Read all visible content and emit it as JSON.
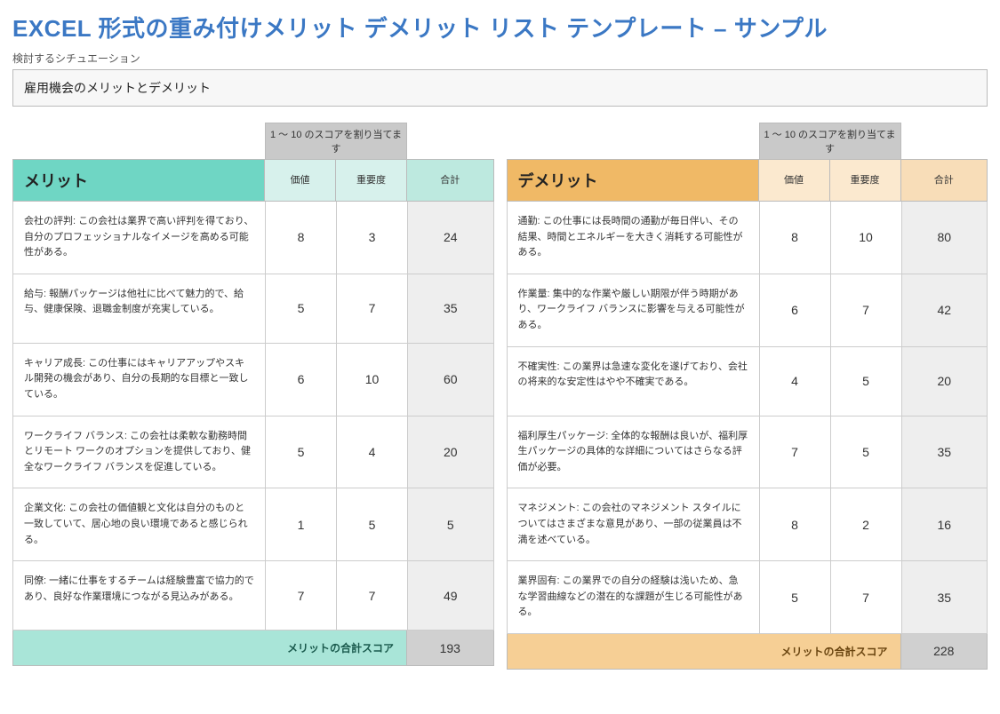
{
  "title": "EXCEL 形式の重み付けメリット デメリット リスト テンプレート – サンプル",
  "subtitle": "検討するシチュエーション",
  "situation": "雇用機会のメリットとデメリット",
  "score_note": "1 ～ 10 のスコアを割り当てます",
  "headers": {
    "value": "価値",
    "importance": "重要度",
    "total": "合計"
  },
  "pros": {
    "heading": "メリット",
    "total_label": "メリットの合計スコア",
    "total_score": "193",
    "rows": [
      {
        "desc": "会社の評判: この会社は業界で高い評判を得ており、自分のプロフェッショナルなイメージを高める可能性がある。",
        "value": "8",
        "importance": "3",
        "total": "24"
      },
      {
        "desc": "給与: 報酬パッケージは他社に比べて魅力的で、給与、健康保険、退職金制度が充実している。",
        "value": "5",
        "importance": "7",
        "total": "35"
      },
      {
        "desc": "キャリア成長: この仕事にはキャリアアップやスキル開発の機会があり、自分の長期的な目標と一致している。",
        "value": "6",
        "importance": "10",
        "total": "60"
      },
      {
        "desc": "ワークライフ バランス: この会社は柔軟な勤務時間とリモート ワークのオプションを提供しており、健全なワークライフ バランスを促進している。",
        "value": "5",
        "importance": "4",
        "total": "20"
      },
      {
        "desc": "企業文化: この会社の価値観と文化は自分のものと一致していて、居心地の良い環境であると感じられる。",
        "value": "1",
        "importance": "5",
        "total": "5"
      },
      {
        "desc": "同僚: 一緒に仕事をするチームは経験豊富で協力的であり、良好な作業環境につながる見込みがある。",
        "value": "7",
        "importance": "7",
        "total": "49"
      }
    ]
  },
  "cons": {
    "heading": "デメリット",
    "total_label": "メリットの合計スコア",
    "total_score": "228",
    "rows": [
      {
        "desc": "通勤: この仕事には長時間の通勤が毎日伴い、その結果、時間とエネルギーを大きく消耗する可能性がある。",
        "value": "8",
        "importance": "10",
        "total": "80"
      },
      {
        "desc": "作業量: 集中的な作業や厳しい期限が伴う時期があり、ワークライフ バランスに影響を与える可能性がある。",
        "value": "6",
        "importance": "7",
        "total": "42"
      },
      {
        "desc": "不確実性: この業界は急速な変化を遂げており、会社の将来的な安定性はやや不確実である。",
        "value": "4",
        "importance": "5",
        "total": "20"
      },
      {
        "desc": "福利厚生パッケージ: 全体的な報酬は良いが、福利厚生パッケージの具体的な詳細についてはさらなる評価が必要。",
        "value": "7",
        "importance": "5",
        "total": "35"
      },
      {
        "desc": "マネジメント: この会社のマネジメント スタイルについてはさまざまな意見があり、一部の従業員は不満を述べている。",
        "value": "8",
        "importance": "2",
        "total": "16"
      },
      {
        "desc": "業界固有: この業界での自分の経験は浅いため、急な学習曲線などの潜在的な課題が生じる可能性がある。",
        "value": "5",
        "importance": "7",
        "total": "35"
      }
    ]
  }
}
